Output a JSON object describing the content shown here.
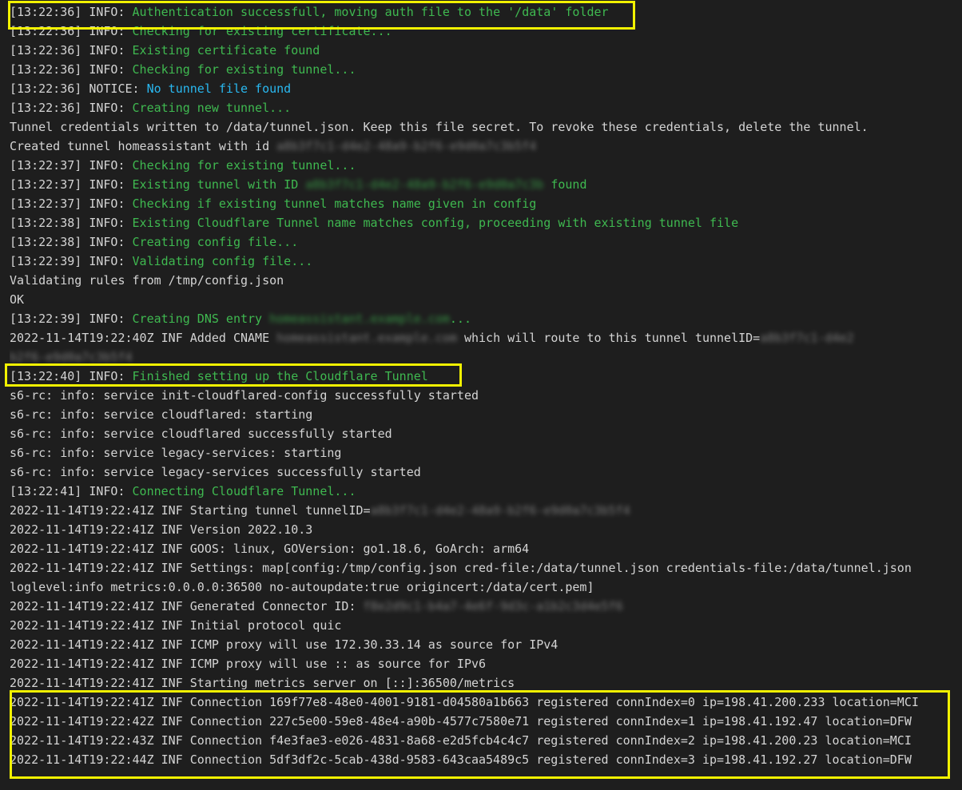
{
  "log": [
    {
      "prefix": "[13:22:36] INFO: ",
      "msg": "Authentication successfull, moving auth file to the '/data' folder",
      "color": "green"
    },
    {
      "prefix": "[13:22:36] INFO: ",
      "msg": "Checking for existing certificate...",
      "color": "green"
    },
    {
      "prefix": "[13:22:36] INFO: ",
      "msg": "Existing certificate found",
      "color": "green"
    },
    {
      "prefix": "[13:22:36] INFO: ",
      "msg": "Checking for existing tunnel...",
      "color": "green"
    },
    {
      "prefix": "[13:22:36] NOTICE: ",
      "msg": "No tunnel file found",
      "color": "blue"
    },
    {
      "prefix": "[13:22:36] INFO: ",
      "msg": "Creating new tunnel...",
      "color": "green"
    },
    {
      "prefix": "",
      "msg": "Tunnel credentials written to /data/tunnel.json. Keep this file secret. To revoke these credentials, delete the tunnel.",
      "color": "white"
    },
    {
      "prefix": "",
      "msg": "Created tunnel homeassistant with id ",
      "color": "white",
      "redacted": "a8b3f7c1-d4e2-48a9-b2f6-e9d0a7c3b5f4",
      "redact_color": "gray"
    },
    {
      "prefix": "[13:22:37] INFO: ",
      "msg": "Checking for existing tunnel...",
      "color": "green"
    },
    {
      "prefix": "[13:22:37] INFO: ",
      "msg": "Existing tunnel with ID ",
      "color": "green",
      "redacted": "a8b3f7c1-d4e2-48a9-b2f6-e9d0a7c3b",
      "redact_color": "green-b",
      "suffix": " found"
    },
    {
      "prefix": "[13:22:37] INFO: ",
      "msg": "Checking if existing tunnel matches name given in config",
      "color": "green"
    },
    {
      "prefix": "[13:22:38] INFO: ",
      "msg": "Existing Cloudflare Tunnel name matches config, proceeding with existing tunnel file",
      "color": "green"
    },
    {
      "prefix": "[13:22:38] INFO: ",
      "msg": "Creating config file...",
      "color": "green"
    },
    {
      "prefix": "[13:22:39] INFO: ",
      "msg": "Validating config file...",
      "color": "green"
    },
    {
      "prefix": "",
      "msg": "Validating rules from /tmp/config.json",
      "color": "white"
    },
    {
      "prefix": "",
      "msg": "OK",
      "color": "white"
    },
    {
      "prefix": "[13:22:39] INFO: ",
      "msg": "Creating DNS entry ",
      "color": "green",
      "redacted": "homeassistant.example.com",
      "redact_color": "green-b",
      "suffix": "..."
    },
    {
      "prefix": "",
      "msg": "2022-11-14T19:22:40Z INF Added CNAME ",
      "color": "white",
      "redacted": "homeassistant.example.com",
      "redact_color": "gray",
      "suffix": " which will route to this tunnel tunnelID=",
      "redacted2": "a8b3f7c1-d4e2"
    },
    {
      "prefix": "",
      "msg": "",
      "color": "white",
      "redacted": "b2f6-e9d0a7c3b5f4",
      "redact_color": "gray"
    },
    {
      "prefix": "[13:22:40] INFO: ",
      "msg": "Finished setting up the Cloudflare Tunnel",
      "color": "green"
    },
    {
      "prefix": "",
      "msg": "s6-rc: info: service init-cloudflared-config successfully started",
      "color": "white"
    },
    {
      "prefix": "",
      "msg": "s6-rc: info: service cloudflared: starting",
      "color": "white"
    },
    {
      "prefix": "",
      "msg": "s6-rc: info: service cloudflared successfully started",
      "color": "white"
    },
    {
      "prefix": "",
      "msg": "s6-rc: info: service legacy-services: starting",
      "color": "white"
    },
    {
      "prefix": "",
      "msg": "s6-rc: info: service legacy-services successfully started",
      "color": "white"
    },
    {
      "prefix": "[13:22:41] INFO: ",
      "msg": "Connecting Cloudflare Tunnel...",
      "color": "green"
    },
    {
      "prefix": "",
      "msg": "2022-11-14T19:22:41Z INF Starting tunnel tunnelID=",
      "color": "white",
      "redacted": "a8b3f7c1-d4e2-48a9-b2f6-e9d0a7c3b5f4",
      "redact_color": "gray"
    },
    {
      "prefix": "",
      "msg": "2022-11-14T19:22:41Z INF Version 2022.10.3",
      "color": "white"
    },
    {
      "prefix": "",
      "msg": "2022-11-14T19:22:41Z INF GOOS: linux, GOVersion: go1.18.6, GoArch: arm64",
      "color": "white"
    },
    {
      "prefix": "",
      "msg": "2022-11-14T19:22:41Z INF Settings: map[config:/tmp/config.json cred-file:/data/tunnel.json credentials-file:/data/tunnel.json",
      "color": "white"
    },
    {
      "prefix": "",
      "msg": "loglevel:info metrics:0.0.0.0:36500 no-autoupdate:true origincert:/data/cert.pem]",
      "color": "white"
    },
    {
      "prefix": "",
      "msg": "2022-11-14T19:22:41Z INF Generated Connector ID: ",
      "color": "white",
      "redacted": "f8e2d9c1-b4a7-4e6f-9d3c-a1b2c3d4e5f6",
      "redact_color": "gray"
    },
    {
      "prefix": "",
      "msg": "2022-11-14T19:22:41Z INF Initial protocol quic",
      "color": "white"
    },
    {
      "prefix": "",
      "msg": "2022-11-14T19:22:41Z INF ICMP proxy will use 172.30.33.14 as source for IPv4",
      "color": "white"
    },
    {
      "prefix": "",
      "msg": "2022-11-14T19:22:41Z INF ICMP proxy will use :: as source for IPv6",
      "color": "white"
    },
    {
      "prefix": "",
      "msg": "2022-11-14T19:22:41Z INF Starting metrics server on [::]:36500/metrics",
      "color": "white"
    },
    {
      "prefix": "",
      "msg": "2022-11-14T19:22:41Z INF Connection 169f77e8-48e0-4001-9181-d04580a1b663 registered connIndex=0 ip=198.41.200.233 location=MCI",
      "color": "white"
    },
    {
      "prefix": "",
      "msg": "2022-11-14T19:22:42Z INF Connection 227c5e00-59e8-48e4-a90b-4577c7580e71 registered connIndex=1 ip=198.41.192.47 location=DFW",
      "color": "white"
    },
    {
      "prefix": "",
      "msg": "2022-11-14T19:22:43Z INF Connection f4e3fae3-e026-4831-8a68-e2d5fcb4c4c7 registered connIndex=2 ip=198.41.200.23 location=MCI",
      "color": "white"
    },
    {
      "prefix": "",
      "msg": "2022-11-14T19:22:44Z INF Connection 5df3df2c-5cab-438d-9583-643caa5489c5 registered connIndex=3 ip=198.41.192.27 location=DFW",
      "color": "white"
    }
  ],
  "highlight_color": "#f2f200"
}
